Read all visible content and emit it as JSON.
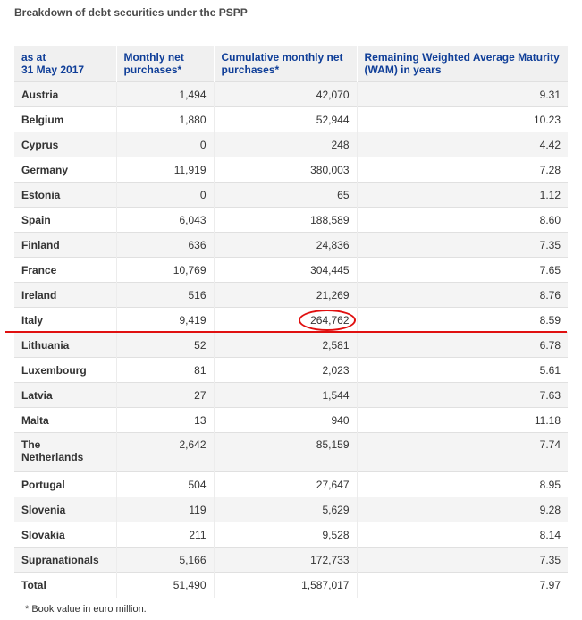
{
  "title": "Breakdown of debt securities under the PSPP",
  "columns": {
    "c1_l1": "as at",
    "c1_l2": "31 May 2017",
    "c2": "Monthly net purchases*",
    "c3": "Cumulative monthly net purchases*",
    "c4": "Remaining Weighted Average Maturity (WAM) in years"
  },
  "rows": [
    {
      "country": "Austria",
      "monthly": "1,494",
      "cumulative": "42,070",
      "wam": "9.31"
    },
    {
      "country": "Belgium",
      "monthly": "1,880",
      "cumulative": "52,944",
      "wam": "10.23"
    },
    {
      "country": "Cyprus",
      "monthly": "0",
      "cumulative": "248",
      "wam": "4.42"
    },
    {
      "country": "Germany",
      "monthly": "11,919",
      "cumulative": "380,003",
      "wam": "7.28"
    },
    {
      "country": "Estonia",
      "monthly": "0",
      "cumulative": "65",
      "wam": "1.12"
    },
    {
      "country": "Spain",
      "monthly": "6,043",
      "cumulative": "188,589",
      "wam": "8.60"
    },
    {
      "country": "Finland",
      "monthly": "636",
      "cumulative": "24,836",
      "wam": "7.35"
    },
    {
      "country": "France",
      "monthly": "10,769",
      "cumulative": "304,445",
      "wam": "7.65"
    },
    {
      "country": "Ireland",
      "monthly": "516",
      "cumulative": "21,269",
      "wam": "8.76"
    },
    {
      "country": "Italy",
      "monthly": "9,419",
      "cumulative": "264,762",
      "wam": "8.59"
    },
    {
      "country": "Lithuania",
      "monthly": "52",
      "cumulative": "2,581",
      "wam": "6.78"
    },
    {
      "country": "Luxembourg",
      "monthly": "81",
      "cumulative": "2,023",
      "wam": "5.61"
    },
    {
      "country": "Latvia",
      "monthly": "27",
      "cumulative": "1,544",
      "wam": "7.63"
    },
    {
      "country": "Malta",
      "monthly": "13",
      "cumulative": "940",
      "wam": "11.18"
    },
    {
      "country_l1": "The",
      "country_l2": "Netherlands",
      "monthly": "2,642",
      "cumulative": "85,159",
      "wam": "7.74"
    },
    {
      "country": "Portugal",
      "monthly": "504",
      "cumulative": "27,647",
      "wam": "8.95"
    },
    {
      "country": "Slovenia",
      "monthly": "119",
      "cumulative": "5,629",
      "wam": "9.28"
    },
    {
      "country": "Slovakia",
      "monthly": "211",
      "cumulative": "9,528",
      "wam": "8.14"
    },
    {
      "country": "Supranationals",
      "monthly": "5,166",
      "cumulative": "172,733",
      "wam": "7.35"
    },
    {
      "country": "Total",
      "monthly": "51,490",
      "cumulative": "1,587,017",
      "wam": "7.97"
    }
  ],
  "footnote": "* Book value in euro million.",
  "annotation_color": "#e01010"
}
